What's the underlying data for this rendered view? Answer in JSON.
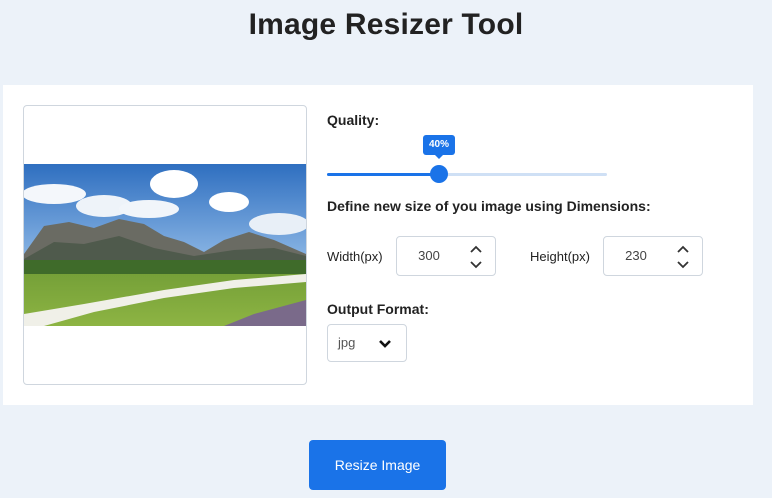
{
  "page_title": "Image Resizer Tool",
  "quality": {
    "label": "Quality:",
    "value": 40,
    "value_label": "40%"
  },
  "dimensions": {
    "heading": "Define new size of you image using Dimensions:",
    "width_label": "Width(px)",
    "width_value": "300",
    "height_label": "Height(px)",
    "height_value": "230"
  },
  "format": {
    "label": "Output Format:",
    "selected": "jpg"
  },
  "resize_button": "Resize Image",
  "colors": {
    "accent": "#1a73e8",
    "page_bg": "#ecf2f9",
    "card_bg": "#ffffff"
  }
}
